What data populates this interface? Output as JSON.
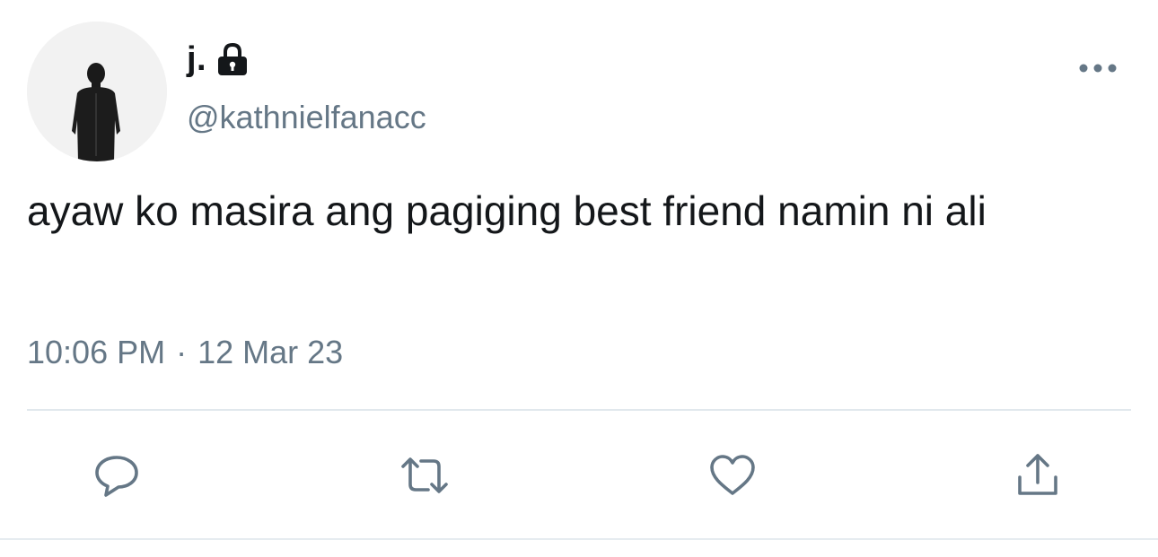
{
  "tweet": {
    "display_name": "j.",
    "handle": "@kathnielfanacc",
    "protected_icon": "lock-icon",
    "avatar_icon": "avatar-silhouette-icon",
    "more_icon": "more-horizontal-icon",
    "text": "ayaw ko masira ang pagiging best friend namin ni ali",
    "time": "10:06 PM",
    "separator": "·",
    "date": "12 Mar 23"
  },
  "actions": [
    {
      "icon": "reply-icon"
    },
    {
      "icon": "retweet-icon"
    },
    {
      "icon": "like-icon"
    },
    {
      "icon": "share-icon"
    }
  ],
  "colors": {
    "text": "#14171a",
    "secondary": "#657786",
    "icon": "#657786",
    "divider": "#e1e8ed"
  }
}
